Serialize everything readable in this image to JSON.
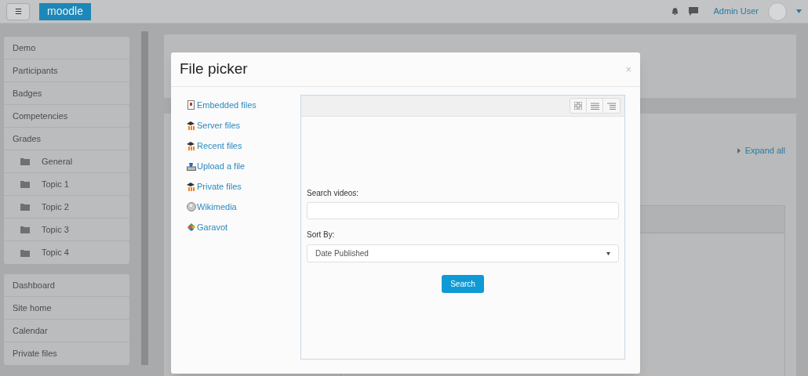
{
  "navbar": {
    "menu_glyph": "☰",
    "brand": "moodle",
    "user_name": "Admin User"
  },
  "sidebar": {
    "groups": [
      {
        "items": [
          {
            "label": "Demo",
            "kind": "link"
          },
          {
            "label": "Participants",
            "kind": "link"
          },
          {
            "label": "Badges",
            "kind": "link"
          },
          {
            "label": "Competencies",
            "kind": "link"
          },
          {
            "label": "Grades",
            "kind": "link"
          },
          {
            "label": "General",
            "kind": "section"
          },
          {
            "label": "Topic 1",
            "kind": "section"
          },
          {
            "label": "Topic 2",
            "kind": "section"
          },
          {
            "label": "Topic 3",
            "kind": "section"
          },
          {
            "label": "Topic 4",
            "kind": "section"
          }
        ]
      },
      {
        "items": [
          {
            "label": "Dashboard",
            "kind": "link"
          },
          {
            "label": "Site home",
            "kind": "link"
          },
          {
            "label": "Calendar",
            "kind": "link"
          },
          {
            "label": "Private files",
            "kind": "link"
          }
        ]
      }
    ]
  },
  "course": {
    "expand_all": "Expand all"
  },
  "dialog": {
    "title": "File picker",
    "close_glyph": "×",
    "repositories": [
      {
        "label": "Embedded files",
        "kind": "embedded"
      },
      {
        "label": "Server files",
        "kind": "moodle"
      },
      {
        "label": "Recent files",
        "kind": "moodle"
      },
      {
        "label": "Upload a file",
        "kind": "upload"
      },
      {
        "label": "Private files",
        "kind": "moodle"
      },
      {
        "label": "Wikimedia",
        "kind": "wikimedia"
      },
      {
        "label": "Garavot",
        "kind": "garavot"
      }
    ],
    "search_label": "Search videos:",
    "sort_label": "Sort By:",
    "sort_value": "Date Published",
    "search_button": "Search"
  }
}
